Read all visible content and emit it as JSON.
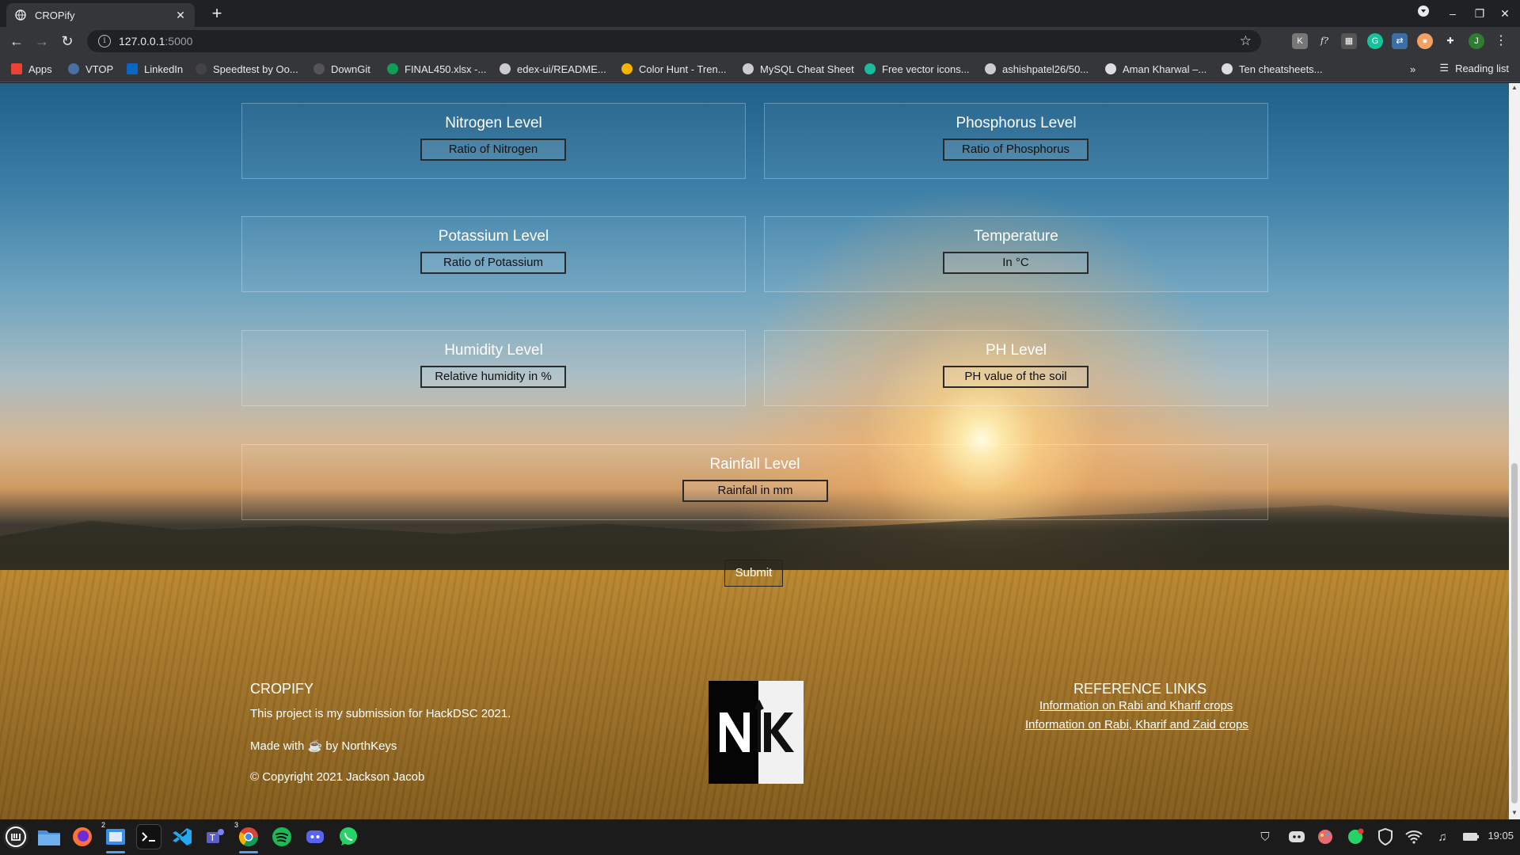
{
  "browser": {
    "tab_title": "CROPify",
    "url_host": "127.0.0.1",
    "url_port": ":5000",
    "bookmarks": [
      {
        "label": "Apps",
        "color": "#ea4335"
      },
      {
        "label": "VTOP",
        "color": "#4a6fa5"
      },
      {
        "label": "LinkedIn",
        "color": "#0a66c2"
      },
      {
        "label": "Speedtest by Oo...",
        "color": "#444444"
      },
      {
        "label": "DownGit",
        "color": "#555555"
      },
      {
        "label": "FINAL450.xlsx -...",
        "color": "#0f9d58"
      },
      {
        "label": "edex-ui/README...",
        "color": "#cccccc"
      },
      {
        "label": "Color Hunt - Tren...",
        "color": "#f4b400"
      },
      {
        "label": "MySQL Cheat Sheet",
        "color": "#cccccc"
      },
      {
        "label": "Free vector icons...",
        "color": "#1abc9c"
      },
      {
        "label": "ashishpatel26/50...",
        "color": "#cccccc"
      },
      {
        "label": "Aman Kharwal –...",
        "color": "#dddddd"
      },
      {
        "label": "Ten cheatsheets...",
        "color": "#dddddd"
      }
    ],
    "overflow": "»",
    "reading_list": "Reading list"
  },
  "form": {
    "nitrogen": {
      "label": "Nitrogen Level",
      "placeholder": "Ratio of Nitrogen"
    },
    "phosphorus": {
      "label": "Phosphorus Level",
      "placeholder": "Ratio of Phosphorus"
    },
    "potassium": {
      "label": "Potassium Level",
      "placeholder": "Ratio of Potassium"
    },
    "temperature": {
      "label": "Temperature",
      "placeholder": "In °C"
    },
    "humidity": {
      "label": "Humidity Level",
      "placeholder": "Relative humidity in %"
    },
    "ph": {
      "label": "PH Level",
      "placeholder": "PH value of the soil"
    },
    "rainfall": {
      "label": "Rainfall Level",
      "placeholder": "Rainfall in mm"
    },
    "submit": "Submit"
  },
  "footer": {
    "title": "CROPIFY",
    "line1": "This project is my submission for HackDSC 2021.",
    "made_with": "Made with ☕ by NorthKeys",
    "copyright": "© Copyright 2021 Jackson Jacob",
    "logo_text": "NK",
    "ref_title": "REFERENCE LINKS",
    "links": [
      "Information on Rabi and Kharif crops",
      "Information on Rabi, Kharif and Zaid crops"
    ]
  },
  "taskbar": {
    "time": "19:05",
    "badges": {
      "files": "2",
      "chrome": "3"
    }
  },
  "colors": {
    "chrome_dark": "#202124",
    "chrome_mid": "#35363a",
    "text_white": "#ffffff"
  }
}
